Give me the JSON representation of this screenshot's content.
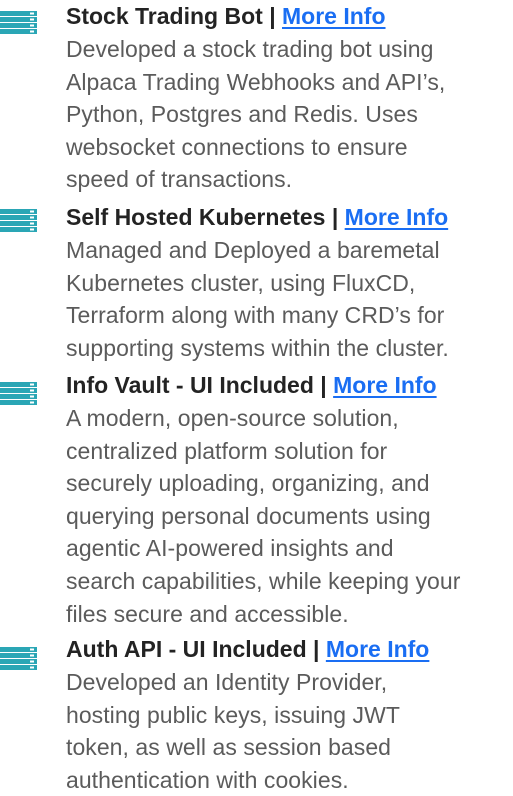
{
  "theme": {
    "icon_color": "#2aa6b5",
    "title_color": "#232323",
    "link_color": "#1a6ef3",
    "desc_color": "#5b5b5b"
  },
  "projects": [
    {
      "title": "Stock Trading Bot",
      "separator": "|",
      "link_label": "More Info",
      "icon": "list-icon",
      "lines": [
        "Developed a stock trading bot using",
        "Alpaca Trading Webhooks and API’s,",
        "Python, Postgres and Redis. Uses",
        "websocket connections to ensure",
        "speed of transactions."
      ]
    },
    {
      "title": "Self Hosted Kubernetes",
      "separator": "|",
      "link_label": "More Info",
      "icon": "list-icon",
      "lines": [
        "Managed and Deployed a baremetal",
        "Kubernetes cluster, using FluxCD,",
        "Terraform along with many CRD’s for",
        "supporting systems within the cluster."
      ]
    },
    {
      "title": "Info Vault - UI Included",
      "separator": "|",
      "link_label": "More Info",
      "icon": "list-icon",
      "lines": [
        "A modern, open-source solution,",
        "centralized platform solution for",
        "securely uploading, organizing, and",
        "querying personal documents using",
        "agentic AI-powered insights and",
        "search capabilities, while keeping your",
        "files secure and accessible."
      ]
    },
    {
      "title": "Auth API - UI Included",
      "separator": "|",
      "link_label": "More Info",
      "icon": "list-icon",
      "lines": [
        "Developed an Identity Provider,",
        "hosting public keys, issuing JWT",
        "token, as well as session based",
        "authentication with cookies."
      ]
    }
  ]
}
